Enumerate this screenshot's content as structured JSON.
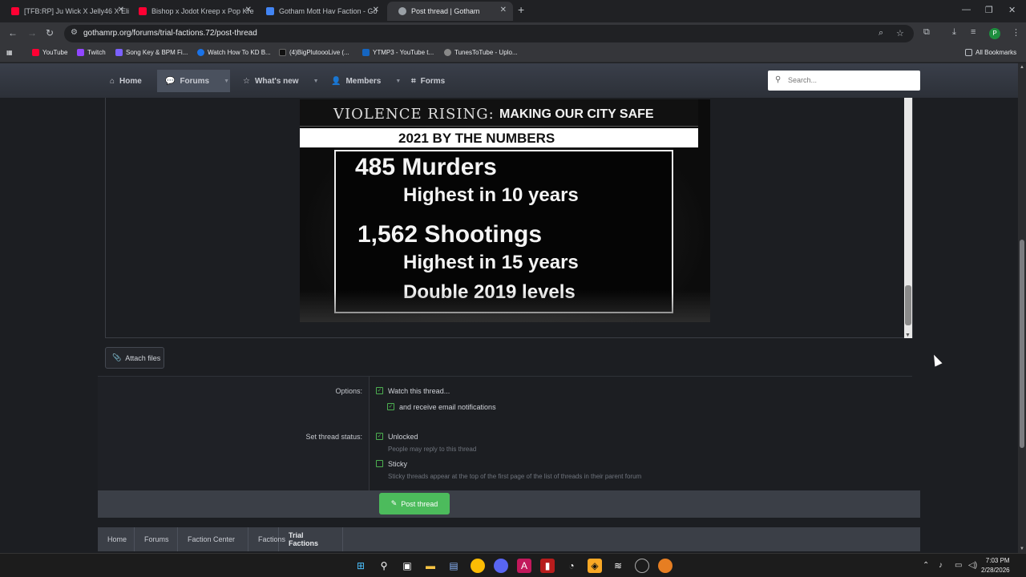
{
  "browser": {
    "tabs": [
      {
        "title": "[TFB:RP] Ju Wick X Jelly46 X Eli",
        "icon": "youtube-icon",
        "color": "#ff0033"
      },
      {
        "title": "Bishop x Jodot Kreep x Pop Kre",
        "icon": "youtube-icon",
        "color": "#ff0033"
      },
      {
        "title": "Gotham Mott Hav Faction - Go",
        "icon": "docs-icon",
        "color": "#4285f4"
      },
      {
        "title": "Post thread | Gotham",
        "icon": "site-icon",
        "color": "#9aa0a6"
      }
    ],
    "new_tab": "+",
    "url": "gothamrp.org/forums/trial-factions.72/post-thread",
    "bookmarks": [
      {
        "label": "YouTube",
        "color": "#ff0033"
      },
      {
        "label": "Twitch",
        "color": "#9146ff"
      },
      {
        "label": "Song Key & BPM Fi...",
        "color": "#7b61ff"
      },
      {
        "label": "Watch How To KD B...",
        "color": "#1a73e8"
      },
      {
        "label": "(4)BigPlutoooLive (...",
        "color": "#111111"
      },
      {
        "label": "YTMP3 - YouTube t...",
        "color": "#1565c0"
      },
      {
        "label": "TunesToTube - Uplo...",
        "color": "#888888"
      }
    ],
    "all_bookmarks": "All Bookmarks",
    "profile_initial": "P"
  },
  "site": {
    "nav": [
      {
        "label": "Home",
        "icon": "home-icon"
      },
      {
        "label": "Forums",
        "icon": "forums-icon"
      },
      {
        "label": "What's new",
        "icon": "star-icon"
      },
      {
        "label": "Members",
        "icon": "members-icon"
      },
      {
        "label": "Forms",
        "icon": "tag-icon"
      }
    ],
    "search_placeholder": "Search..."
  },
  "embed": {
    "header_left": "VIOLENCE RISING:",
    "header_right": "MAKING OUR CITY SAFE",
    "subtitle": "2021 BY THE NUMBERS",
    "line1": "485 Murders",
    "line2": "Highest in 10 years",
    "line3": "1,562 Shootings",
    "line4": "Highest in 15 years",
    "line5": "Double 2019 levels"
  },
  "form": {
    "attach_label": "Attach files",
    "options_label": "Options:",
    "watch_label": "Watch this thread...",
    "email_label": "and receive email notifications",
    "status_label": "Set thread status:",
    "unlocked_label": "Unlocked",
    "unlocked_hint": "People may reply to this thread",
    "sticky_label": "Sticky",
    "sticky_hint": "Sticky threads appear at the top of the first page of the list of threads in their parent forum",
    "post_button": "Post thread"
  },
  "breadcrumbs": [
    "Home",
    "Forums",
    "Faction Center",
    "Factions",
    "Trial Factions"
  ],
  "taskbar": {
    "time": "7:03 PM",
    "date": "2/28/2026"
  }
}
